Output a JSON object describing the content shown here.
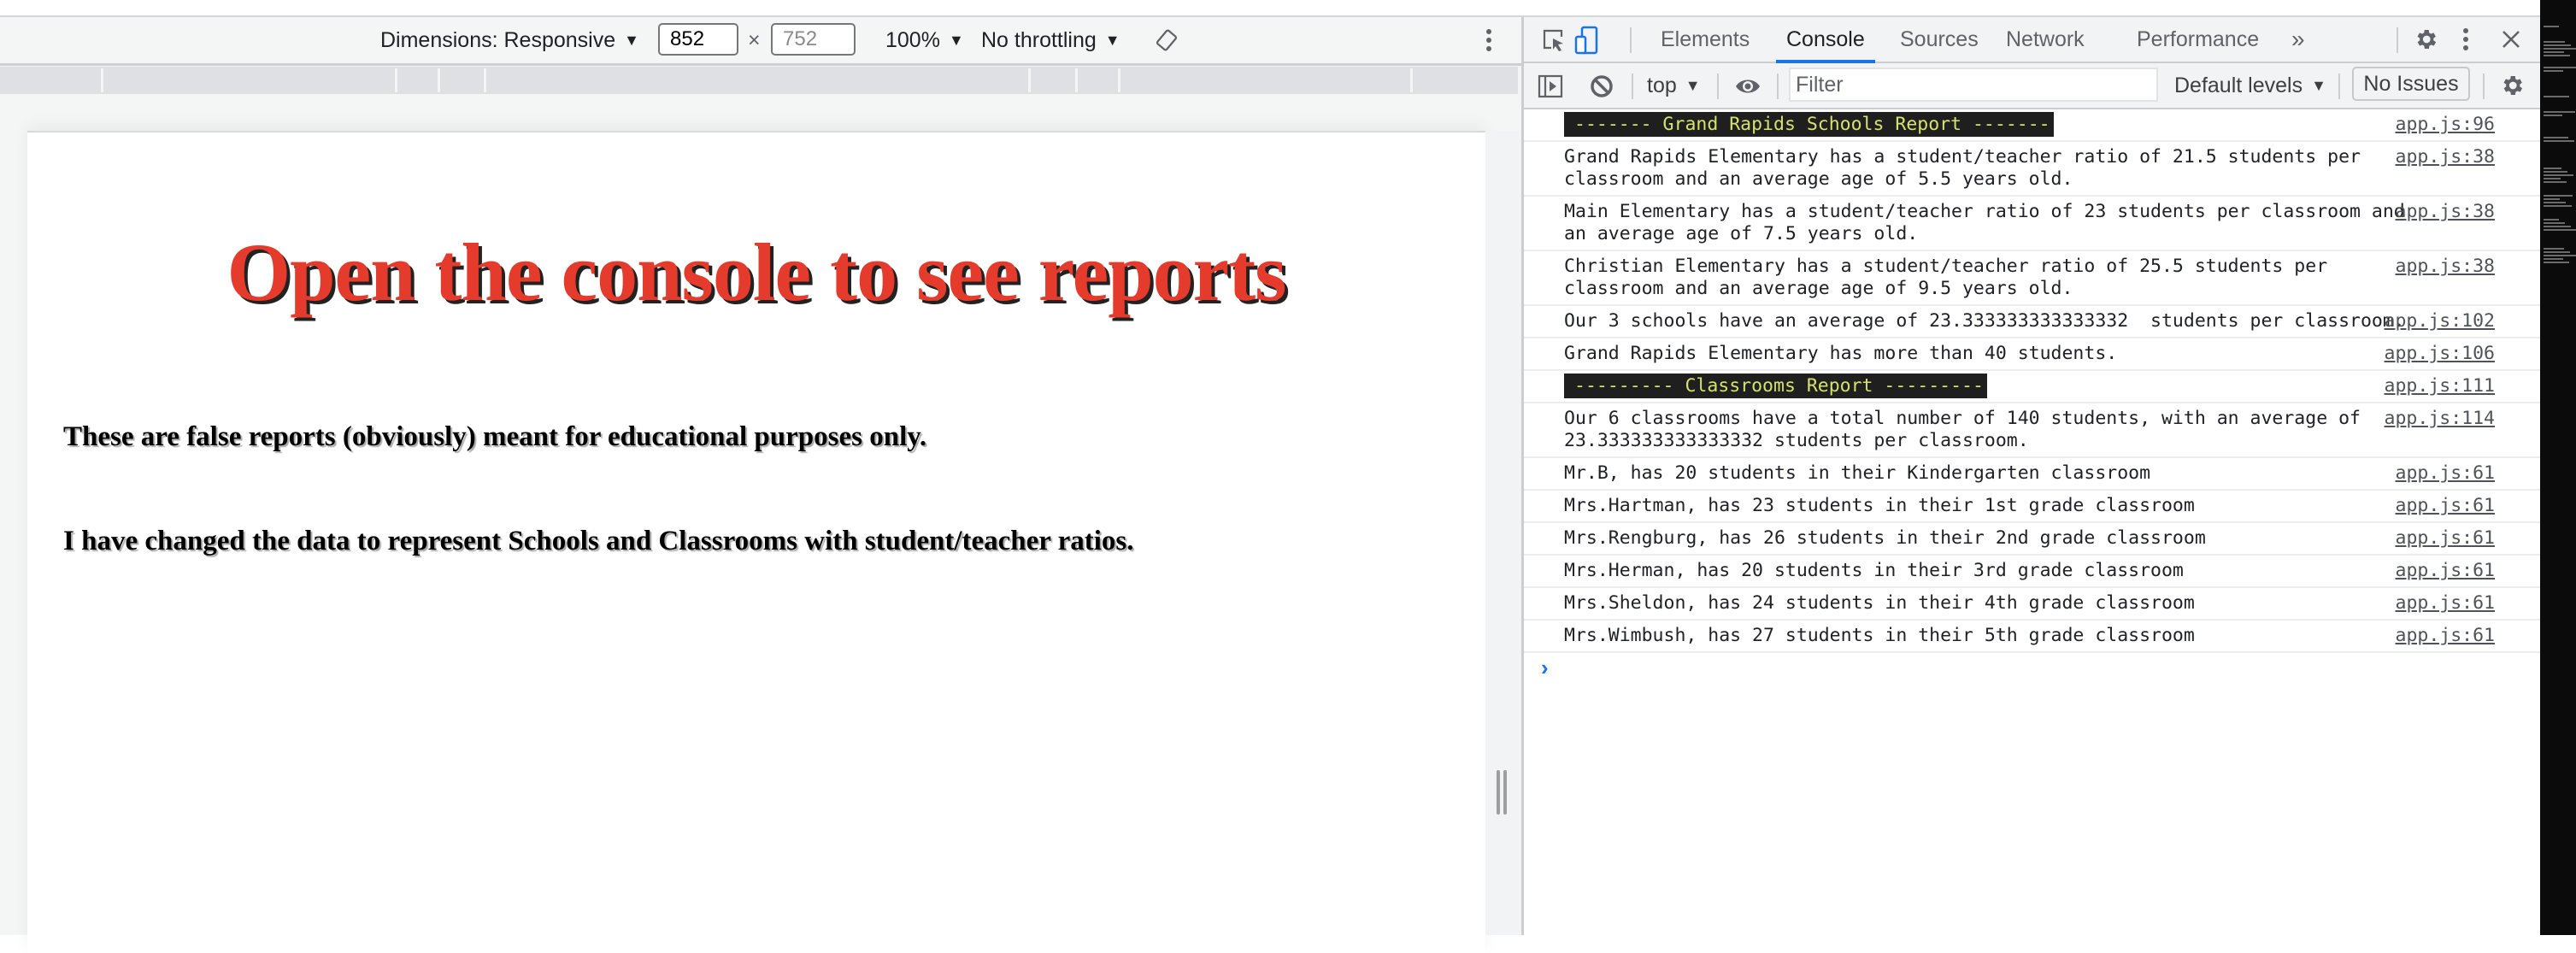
{
  "device_toolbar": {
    "dimensions_label": "Dimensions: Responsive",
    "width_value": "852",
    "times_label": "×",
    "height_value": "752",
    "zoom_label": "100%",
    "throttling_label": "No throttling",
    "dropdown_glyph": "▼",
    "rotate_icon": "rotate-icon",
    "more_icon": "more-vertical-icon"
  },
  "page": {
    "heading": "Open the console to see reports",
    "paragraphs": [
      "These are false reports (obviously) meant for educational purposes only.",
      "I have changed the data to represent Schools and Classrooms with student/teacher ratios."
    ],
    "heading_color": "#e53b2c"
  },
  "devtools": {
    "tabs": [
      {
        "label": "Elements",
        "active": false
      },
      {
        "label": "Console",
        "active": true
      },
      {
        "label": "Sources",
        "active": false
      },
      {
        "label": "Network",
        "active": false
      },
      {
        "label": "Performance",
        "active": false
      }
    ],
    "more_tabs_glyph": "»",
    "console_toolbar": {
      "context": "top",
      "filter_placeholder": "Filter",
      "levels": "Default levels",
      "issues": "No Issues"
    },
    "accent_color": "#1a73e8",
    "messages": [
      {
        "text": "------- Grand Rapids Schools Report -------",
        "source": "app.js:96",
        "banner": true
      },
      {
        "text": "Grand Rapids Elementary has a student/teacher ratio of 21.5 students per classroom and an average age of 5.5 years old.",
        "source": "app.js:38",
        "banner": false
      },
      {
        "text": "Main Elementary has a student/teacher ratio of 23 students per classroom and an average age of 7.5 years old.",
        "source": "app.js:38",
        "banner": false
      },
      {
        "text": "Christian Elementary has a student/teacher ratio of 25.5 students per classroom and an average age of 9.5 years old.",
        "source": "app.js:38",
        "banner": false
      },
      {
        "text": "Our 3 schools have an average of 23.333333333333332  students per classroom.",
        "source": "app.js:102",
        "banner": false
      },
      {
        "text": "Grand Rapids Elementary has more than 40 students.",
        "source": "app.js:106",
        "banner": false
      },
      {
        "text": "--------- Classrooms Report ---------",
        "source": "app.js:111",
        "banner": true
      },
      {
        "text": "Our 6 classrooms have a total number of 140 students, with an average of 23.333333333333332 students per classroom.",
        "source": "app.js:114",
        "banner": false
      },
      {
        "text": "Mr.B, has 20 students in their Kindergarten classroom",
        "source": "app.js:61",
        "banner": false
      },
      {
        "text": "Mrs.Hartman, has 23 students in their 1st grade classroom",
        "source": "app.js:61",
        "banner": false
      },
      {
        "text": "Mrs.Rengburg, has 26 students in their 2nd grade classroom",
        "source": "app.js:61",
        "banner": false
      },
      {
        "text": "Mrs.Herman, has 20 students in their 3rd grade classroom",
        "source": "app.js:61",
        "banner": false
      },
      {
        "text": "Mrs.Sheldon, has 24 students in their 4th grade classroom",
        "source": "app.js:61",
        "banner": false
      },
      {
        "text": "Mrs.Wimbush, has 27 students in their 5th grade classroom",
        "source": "app.js:61",
        "banner": false
      }
    ],
    "prompt_glyph": "›"
  }
}
